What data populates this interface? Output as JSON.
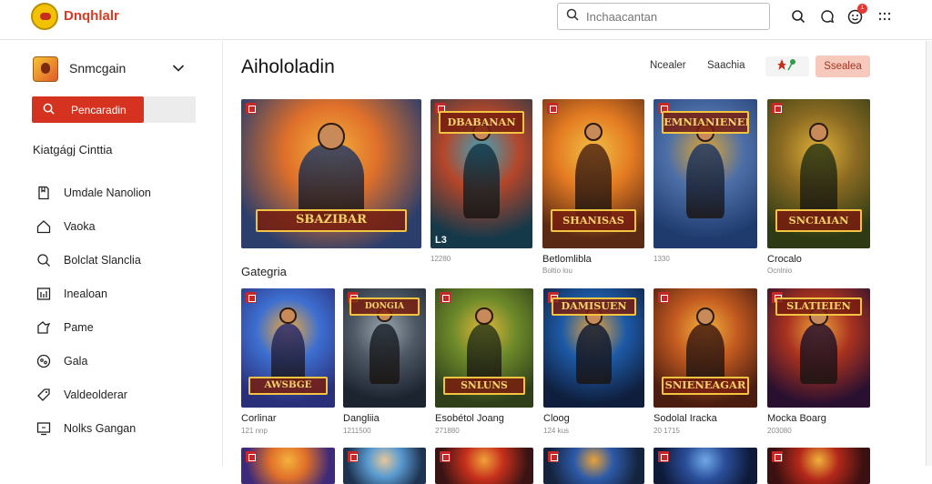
{
  "header": {
    "brand": "Dnqhlalr",
    "search_placeholder": "Inchaacantan",
    "notification_count": "1"
  },
  "sidebar": {
    "account_name": "Snmcgain",
    "cta_label": "Pencaradin",
    "section_title": "Kiatgágj Cinttia",
    "items": [
      {
        "label": "Umdale Nanolion",
        "icon": "bookmark-icon"
      },
      {
        "label": "Vaoka",
        "icon": "home-icon"
      },
      {
        "label": "Bolclat Slanclia",
        "icon": "search-icon"
      },
      {
        "label": "Inealoan",
        "icon": "chart-icon"
      },
      {
        "label": "Pame",
        "icon": "gamepad-icon"
      },
      {
        "label": "Gala",
        "icon": "compass-icon"
      },
      {
        "label": "Valdeolderar",
        "icon": "tag-icon"
      },
      {
        "label": "Nolks Gangan",
        "icon": "monitor-icon"
      }
    ]
  },
  "main": {
    "title": "Aihololadin",
    "filters": [
      "Ncealer",
      "Saachia"
    ],
    "primary_button": "Ssealea",
    "category_title": "Gategria",
    "row1": [
      {
        "title": "",
        "meta": "",
        "art_text": "SBAZIBAR",
        "colors": [
          "#2c3e6b",
          "#e0702a",
          "#f4b23c"
        ],
        "bottom_text": ""
      },
      {
        "title": "",
        "meta": "12280",
        "art_text": "DBABANAN",
        "colors": [
          "#16394a",
          "#b5462a",
          "#3fa3b8"
        ],
        "bottom_text": "L3"
      },
      {
        "title": "Betlomlibla",
        "meta": "Boltio lou",
        "art_text": "SHANISAS",
        "colors": [
          "#5a2a14",
          "#e47b22",
          "#f2c045"
        ],
        "bottom_text": ""
      },
      {
        "title": "",
        "meta": "1330",
        "art_text": "EMNIANIENER",
        "colors": [
          "#1f3b6e",
          "#4d6fa8",
          "#e0a530"
        ],
        "bottom_text": ""
      },
      {
        "title": "Crocalo",
        "meta": "Ocnlnio",
        "art_text": "SNCIAIAN",
        "colors": [
          "#2e3a14",
          "#8a6a22",
          "#e0b03a"
        ],
        "bottom_text": ""
      }
    ],
    "row2": [
      {
        "title": "Corlinar",
        "meta": "121 nnp",
        "art_text": "AWSBGE",
        "colors": [
          "#2a2f7a",
          "#3d6fd1",
          "#f0a93a"
        ],
        "bottom_text": ""
      },
      {
        "title": "Dangliia",
        "meta": "1211500",
        "art_text": "DONGIA",
        "colors": [
          "#1c2430",
          "#4f5a66",
          "#9aa6b0"
        ],
        "bottom_text": ""
      },
      {
        "title": "Esobétol Joang",
        "meta": "271880",
        "art_text": "SNLUNS",
        "colors": [
          "#2f3f1a",
          "#6d8a2a",
          "#e3b739"
        ],
        "bottom_text": ""
      },
      {
        "title": "Cloog",
        "meta": "124 kus",
        "art_text": "DAMISUEN",
        "colors": [
          "#0f1e3c",
          "#1d5aa6",
          "#e8a23a"
        ],
        "bottom_text": ""
      },
      {
        "title": "Sodolal Iracka",
        "meta": "20 1715",
        "art_text": "SNIENEAGAR",
        "colors": [
          "#4a1d10",
          "#c25a20",
          "#f4b23c"
        ],
        "bottom_text": ""
      },
      {
        "title": "Mocka Boarg",
        "meta": "203080",
        "art_text": "SLATIEIEN",
        "colors": [
          "#2a1030",
          "#a8321f",
          "#f0a23a"
        ],
        "bottom_text": ""
      }
    ],
    "row3": [
      {
        "colors": [
          "#3d2a7a",
          "#e0702a",
          "#f4b23c"
        ]
      },
      {
        "colors": [
          "#1e3350",
          "#5a9bd1",
          "#e4c79a"
        ]
      },
      {
        "colors": [
          "#3a1414",
          "#c62f1c",
          "#f0a23a"
        ]
      },
      {
        "colors": [
          "#14243e",
          "#2d5aa8",
          "#e8a23a"
        ]
      },
      {
        "colors": [
          "#0e1a38",
          "#2a4e9a",
          "#6fa8e8"
        ]
      },
      {
        "colors": [
          "#3a1010",
          "#b3281a",
          "#f0b23a"
        ]
      }
    ]
  }
}
